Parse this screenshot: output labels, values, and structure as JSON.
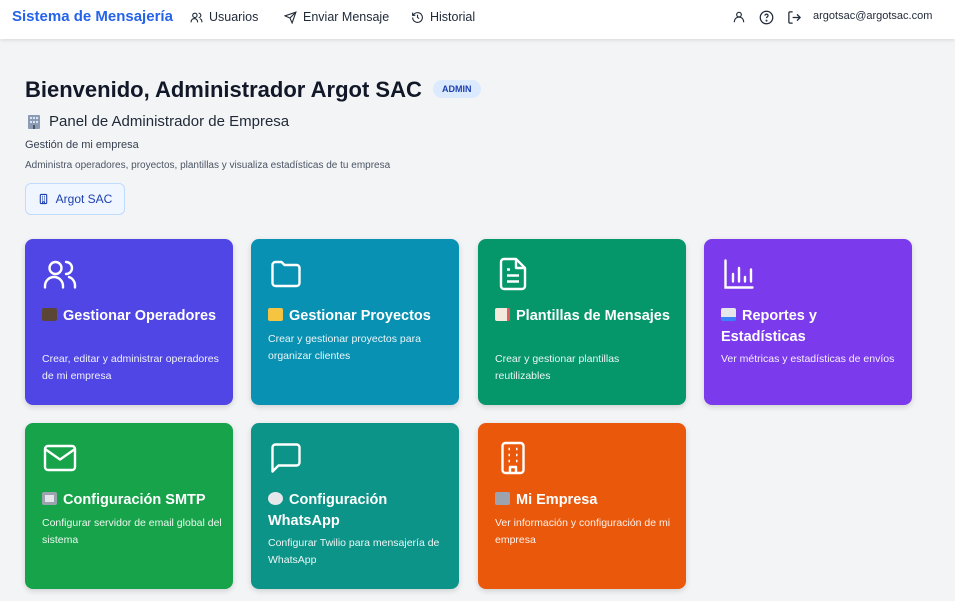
{
  "nav": {
    "brand": "Sistema de Mensajería",
    "links": [
      {
        "label": "Usuarios",
        "icon": "users-icon"
      },
      {
        "label": "Enviar Mensaje",
        "icon": "send-icon"
      },
      {
        "label": "Historial",
        "icon": "history-icon"
      }
    ],
    "right_icons": [
      "user-icon",
      "help-icon",
      "logout-icon"
    ],
    "user_email": "argotsac@argotsac.com"
  },
  "header": {
    "welcome": "Bienvenido, Administrador Argot SAC",
    "role_badge": "ADMIN",
    "panel_title": "Panel de Administrador de Empresa",
    "subtitle": "Gestión de mi empresa",
    "description": "Administra operadores, proyectos, plantillas y visualiza estadísticas de tu empresa",
    "company": "Argot SAC"
  },
  "cards": [
    {
      "title": "Gestionar Operadores",
      "text": "Crear, editar y administrar operadores de mi empresa",
      "icon": "users-icon",
      "color": "#4f46e5"
    },
    {
      "title": "Gestionar Proyectos",
      "text": "Crear y gestionar proyectos para organizar clientes",
      "icon": "folder-icon",
      "color": "#0891b2"
    },
    {
      "title": "Plantillas de Mensajes",
      "text": "Crear y gestionar plantillas reutilizables",
      "icon": "document-icon",
      "color": "#059669"
    },
    {
      "title": "Reportes y Estadísticas",
      "text": "Ver métricas y estadísticas de envíos",
      "icon": "bar-chart-icon",
      "color": "#7c3aed"
    },
    {
      "title": "Configuración SMTP",
      "text": "Configurar servidor de email global del sistema",
      "icon": "mail-icon",
      "color": "#16a34a"
    },
    {
      "title": "Configuración WhatsApp",
      "text": "Configurar Twilio para mensajería de WhatsApp",
      "icon": "chat-icon",
      "color": "#0d9488"
    },
    {
      "title": "Mi Empresa",
      "text": "Ver información y configuración de mi empresa",
      "icon": "building-icon",
      "color": "#ea580c"
    }
  ]
}
